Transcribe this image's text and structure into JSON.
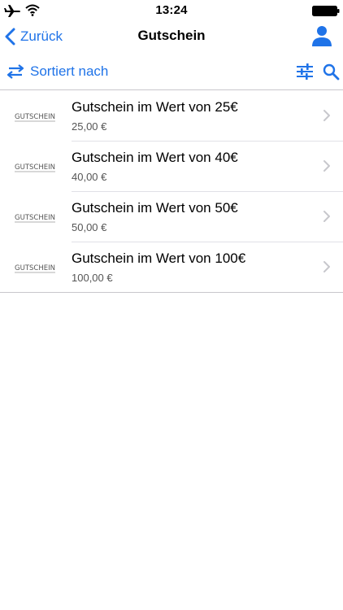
{
  "status_bar": {
    "time": "13:24"
  },
  "nav": {
    "back_label": "Zurück",
    "title": "Gutschein"
  },
  "toolbar": {
    "sort_label": "Sortiert nach"
  },
  "items": [
    {
      "title": "Gutschein im Wert von 25€",
      "price": "25,00 €",
      "thumb_text": "GUTSCHEIN"
    },
    {
      "title": "Gutschein im Wert von 40€",
      "price": "40,00 €",
      "thumb_text": "GUTSCHEIN"
    },
    {
      "title": "Gutschein im Wert von 50€",
      "price": "50,00 €",
      "thumb_text": "GUTSCHEIN"
    },
    {
      "title": "Gutschein im Wert von 100€",
      "price": "100,00 €",
      "thumb_text": "GUTSCHEIN"
    }
  ],
  "colors": {
    "accent": "#1f73e8",
    "separator": "#c8c7cc",
    "secondary_text": "#555555"
  },
  "icons": [
    "airplane-icon",
    "wifi-icon",
    "battery-icon",
    "chevron-left-icon",
    "user-icon",
    "sort-arrows-icon",
    "filter-sliders-icon",
    "search-icon",
    "chevron-right-icon"
  ]
}
